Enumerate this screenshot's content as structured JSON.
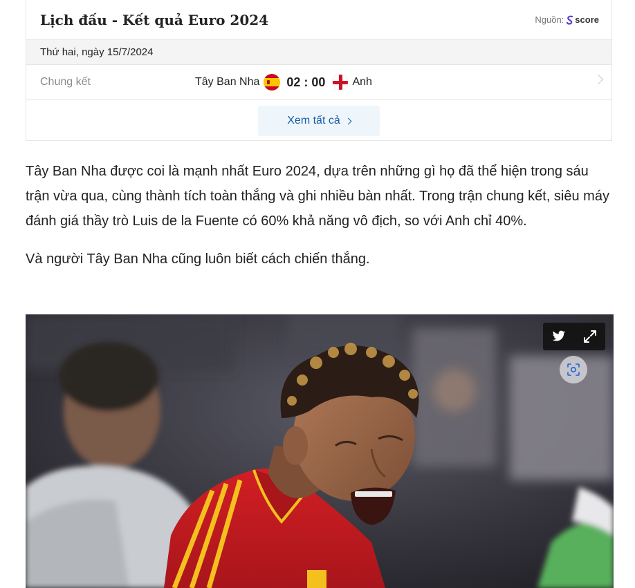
{
  "widget": {
    "title": "Lịch đấu - Kết quả Euro 2024",
    "source_label": "Nguồn:",
    "source_brand": "score",
    "date": "Thứ hai, ngày 15/7/2024",
    "match": {
      "round": "Chung kết",
      "home_team": "Tây Ban Nha",
      "home_flag": "spain-flag-icon",
      "score": "02 : 00",
      "away_team": "Anh",
      "away_flag": "england-flag-icon"
    },
    "see_all_label": "Xem tất cả"
  },
  "article": {
    "paragraphs": [
      "Tây Ban Nha được coi là mạnh nhất Euro 2024, dựa trên những gì họ đã thể hiện trong sáu trận vừa qua, cùng thành tích toàn thắng và ghi nhiều bàn nhất. Trong trận chung kết, siêu máy đánh giá thầy trò Luis de la Fuente có 60% khả năng vô địch, so với Anh chỉ 40%.",
      "Và người Tây Ban Nha cũng luôn biết cách chiến thắng."
    ]
  },
  "photo": {
    "icons": [
      "twitter-icon",
      "fullscreen-icon",
      "image-search-icon"
    ]
  },
  "colors": {
    "link_blue": "#1a5ea8",
    "button_bg": "#eef6fb",
    "date_bg": "#f4f4f4",
    "spain_red": "#c60b1e",
    "spain_yellow": "#ffc400"
  }
}
